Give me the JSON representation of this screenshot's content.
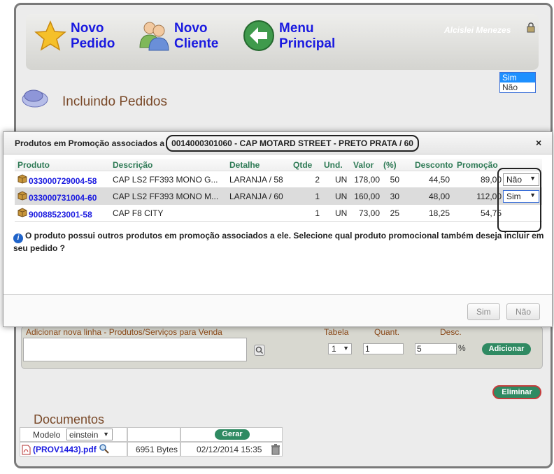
{
  "nav": {
    "novo_pedido": "Novo Pedido",
    "novo_cliente": "Novo Cliente",
    "menu_principal": "Menu Principal",
    "user": "Alcislei Menezes"
  },
  "page": {
    "title": "Incluindo Pedidos"
  },
  "modal": {
    "title_prefix": "Produtos em Promoção associados a",
    "title_product": "0014000301060 - CAP MOTARD STREET - PRETO PRATA / 60",
    "close": "×",
    "columns": [
      "Produto",
      "Descrição",
      "Detalhe",
      "Qtde",
      "Und.",
      "Valor",
      "(%)",
      "Desconto",
      "Promoção"
    ],
    "rows": [
      {
        "code": "033000729004-58",
        "desc": "CAP LS2 FF393 MONO G...",
        "detail": "LARANJA / 58",
        "qty": "2",
        "unit": "UN",
        "valor": "178,00",
        "pct": "50",
        "desconto": "44,50",
        "promocao": "89,00",
        "choice": "Não",
        "has_select": true
      },
      {
        "code": "033000731004-60",
        "desc": "CAP LS2 FF393 MONO M...",
        "detail": "LARANJA / 60",
        "qty": "1",
        "unit": "UN",
        "valor": "160,00",
        "pct": "30",
        "desconto": "48,00",
        "promocao": "112,00",
        "choice": "Sim",
        "has_select": true
      },
      {
        "code": "90088523001-58",
        "desc": "CAP F8 CITY",
        "detail": "",
        "qty": "1",
        "unit": "UN",
        "valor": "73,00",
        "pct": "25",
        "desconto": "18,25",
        "promocao": "54,75",
        "choice": "",
        "has_select": false
      }
    ],
    "dropdown_options": [
      "Sim",
      "Não"
    ],
    "dropdown_highlighted": "Sim",
    "info": "O produto possui outros produtos em promoção associados a ele. Selecione qual produto promocional também deseja incluir em seu pedido ?",
    "btn_sim": "Sim",
    "btn_nao": "Não"
  },
  "add_panel": {
    "header": "Adicionar nova linha - Produtos/Serviços para Venda",
    "tabela_label": "Tabela",
    "quant_label": "Quant.",
    "desc_label": "Desc.",
    "tabela_value": "1",
    "quant_value": "1",
    "desc_value": "5",
    "pct": "%",
    "add_btn": "Adicionar"
  },
  "eliminar": "Eliminar",
  "documentos": {
    "title": "Documentos",
    "modelo_label": "Modelo",
    "modelo_value": "einstein",
    "gerar": "Gerar",
    "file": "(PROV1443).pdf",
    "size": "6951 Bytes",
    "date": "02/12/2014 15:35"
  },
  "colors": {
    "link": "#1a1ae0",
    "header_green": "#2e7a55",
    "button_green": "#2f8a62",
    "title_brown": "#7a4a2a"
  }
}
